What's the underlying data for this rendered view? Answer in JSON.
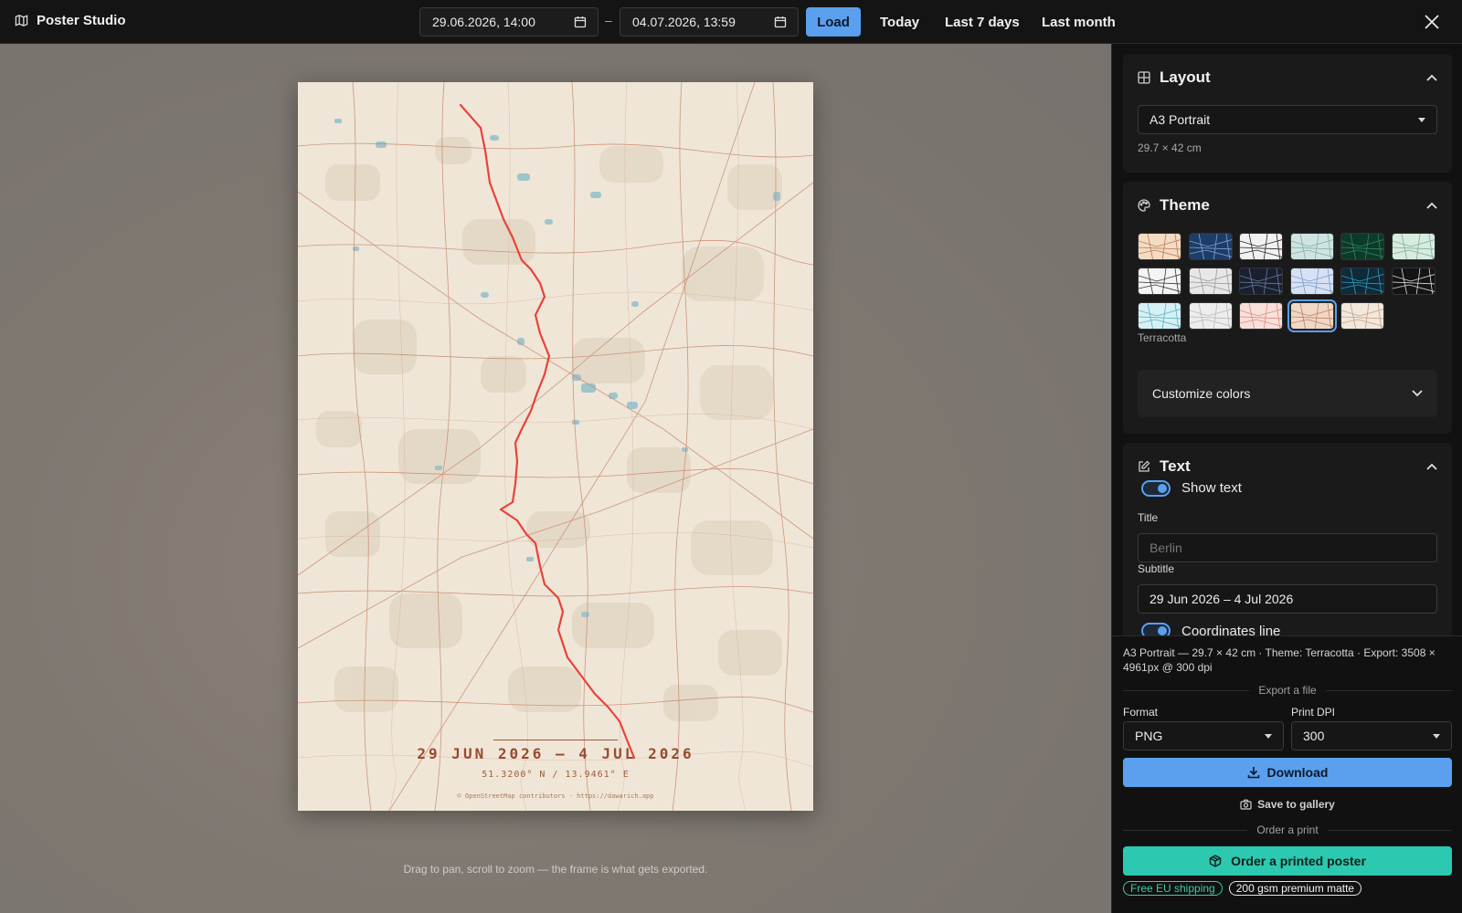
{
  "app": {
    "title": "Poster Studio"
  },
  "toolbar": {
    "start_date": "29.06.2026, 14:00",
    "end_date": "04.07.2026, 13:59",
    "separator": "–",
    "load_label": "Load",
    "today_label": "Today",
    "last7_label": "Last 7 days",
    "lastmonth_label": "Last month"
  },
  "poster": {
    "date_line": "29 JUN 2026 – 4 JUL 2026",
    "coords_line": "51.3200° N / 13.9461° E",
    "credit_line": "© OpenStreetMap contributors · https://dawarich.app",
    "route_color": "#e8433a"
  },
  "canvas": {
    "hint": "Drag to pan, scroll to zoom — the frame is what gets exported."
  },
  "layout_panel": {
    "title": "Layout",
    "selected": "A3 Portrait",
    "dimensions": "29.7 × 42 cm"
  },
  "theme_panel": {
    "title": "Theme",
    "selected_name": "Terracotta",
    "customize_label": "Customize colors",
    "swatches": [
      {
        "bg": "#f3dcc4",
        "line": "#c07a55"
      },
      {
        "bg": "#1e3d66",
        "line": "#7fa6d6"
      },
      {
        "bg": "#f1f1f1",
        "line": "#222222"
      },
      {
        "bg": "#cfe4e0",
        "line": "#7fb0a8"
      },
      {
        "bg": "#0e3a2a",
        "line": "#2f8a62"
      },
      {
        "bg": "#d8ebe0",
        "line": "#7fae94"
      },
      {
        "bg": "#f4f4f4",
        "line": "#333333"
      },
      {
        "bg": "#e7e7e7",
        "line": "#999999"
      },
      {
        "bg": "#1a2030",
        "line": "#6a7ea0"
      },
      {
        "bg": "#d6e2f4",
        "line": "#7a98c8"
      },
      {
        "bg": "#0f2a38",
        "line": "#2aa0c0"
      },
      {
        "bg": "#141414",
        "line": "#e0e0e0"
      },
      {
        "bg": "#d8f0f4",
        "line": "#5ab0c8"
      },
      {
        "bg": "#ededed",
        "line": "#b8b8b8"
      },
      {
        "bg": "#f8e0dc",
        "line": "#e08a7a"
      },
      {
        "bg": "#efd8c8",
        "line": "#c0805a"
      },
      {
        "bg": "#f2e8dc",
        "line": "#c4a08a"
      }
    ]
  },
  "text_panel": {
    "title": "Text",
    "show_text_label": "Show text",
    "title_label": "Title",
    "title_placeholder": "Berlin",
    "subtitle_label": "Subtitle",
    "subtitle_value": "29 Jun 2026 – 4 Jul 2026",
    "coords_label": "Coordinates line"
  },
  "export": {
    "summary": "A3 Portrait — 29.7 × 42 cm · Theme: Terracotta · Export: 3508 × 4961px @ 300 dpi",
    "file_section": "Export a file",
    "format_label": "Format",
    "format_value": "PNG",
    "dpi_label": "Print DPI",
    "dpi_value": "300",
    "download_label": "Download",
    "gallery_label": "Save to gallery",
    "print_section": "Order a print",
    "order_label": "Order a printed poster",
    "badge_shipping": "Free EU shipping",
    "badge_paper": "200 gsm premium matte"
  },
  "colors": {
    "accent": "#5aa0ee",
    "order": "#2cc9b0"
  }
}
